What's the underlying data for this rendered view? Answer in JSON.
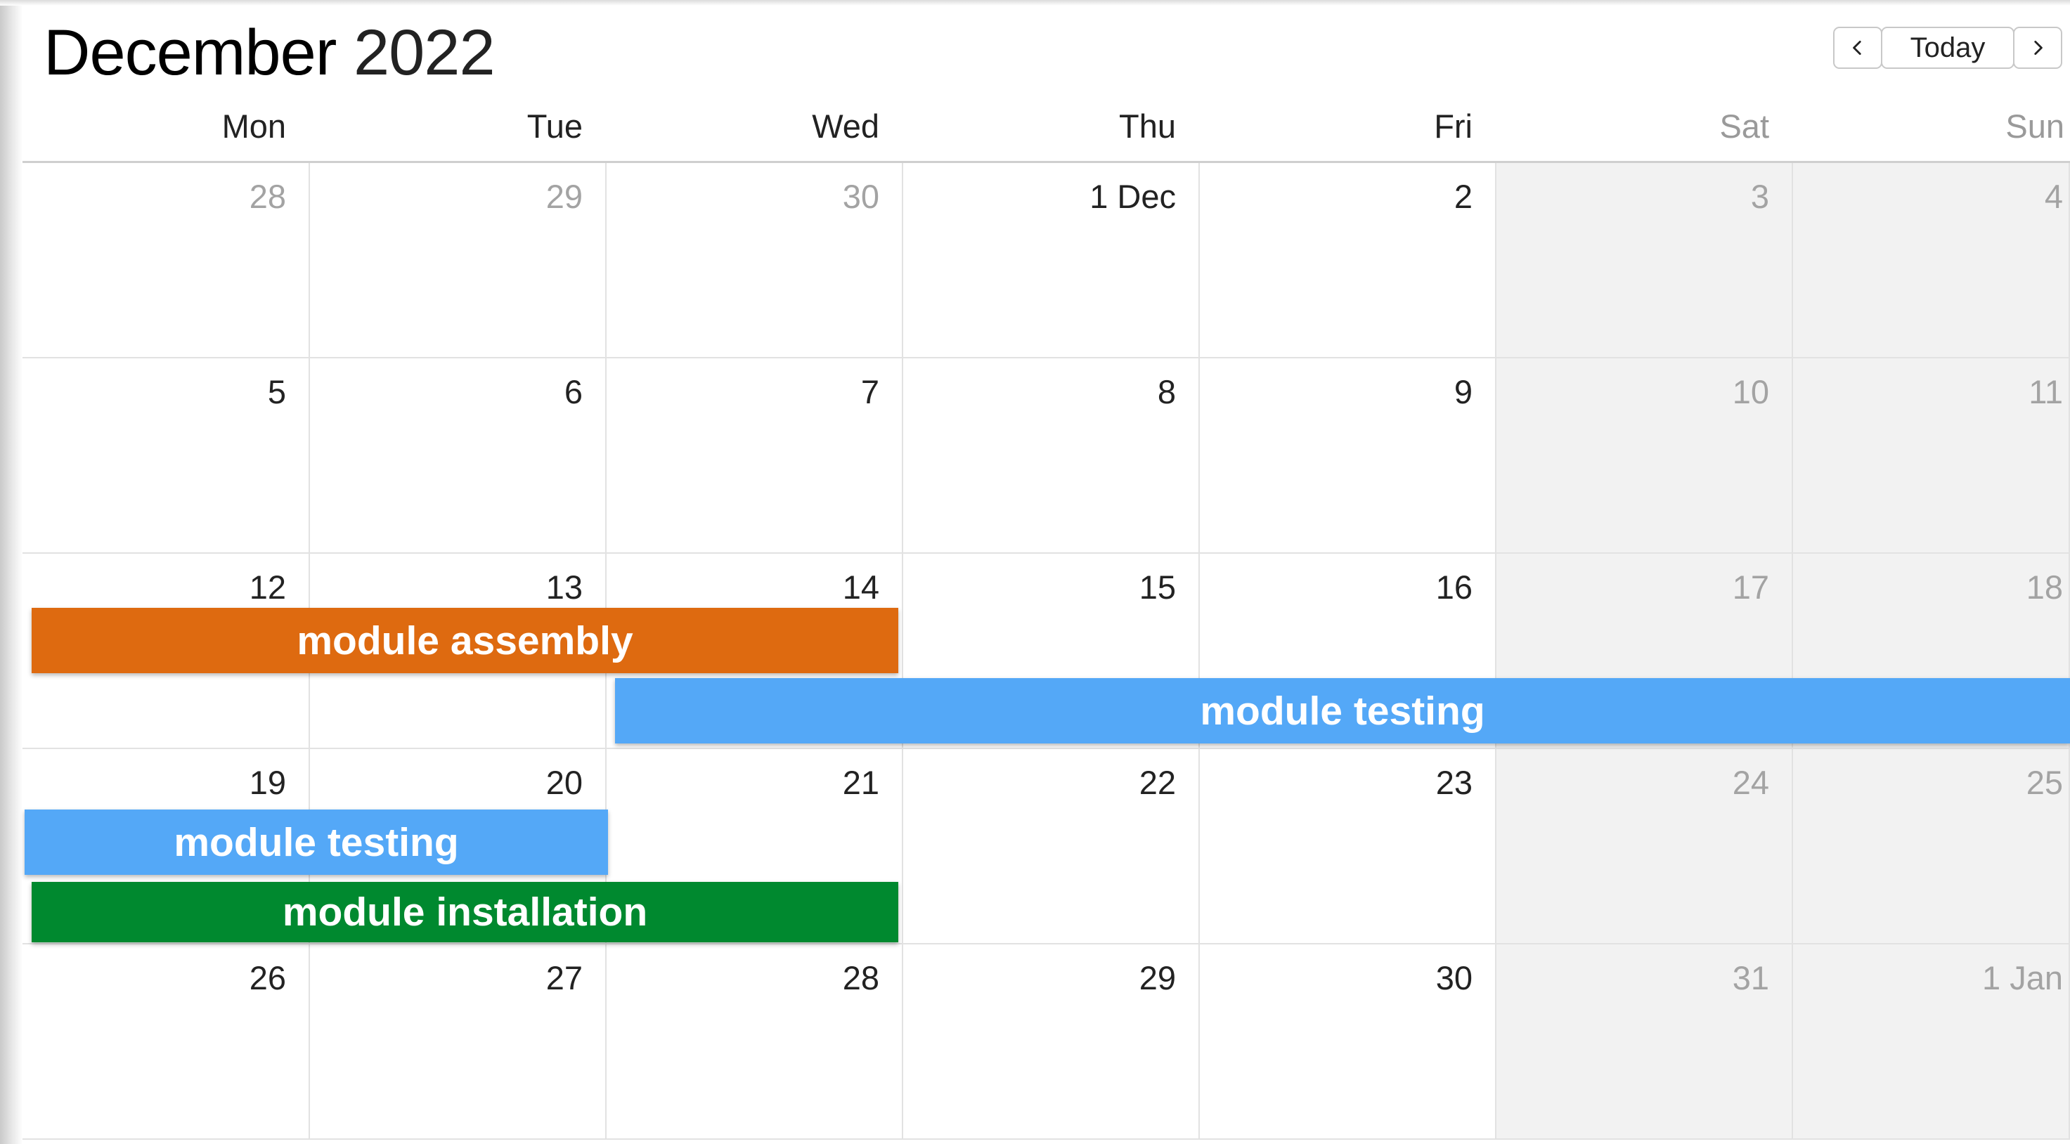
{
  "header": {
    "month": "December",
    "year": "2022",
    "prev_icon": "chevron-left-icon",
    "next_icon": "chevron-right-icon",
    "today_label": "Today"
  },
  "weekdays": [
    "Mon",
    "Tue",
    "Wed",
    "Thu",
    "Fri",
    "Sat",
    "Sun"
  ],
  "weeks": [
    [
      "28",
      "29",
      "30",
      "1 Dec",
      "2",
      "3",
      "4"
    ],
    [
      "5",
      "6",
      "7",
      "8",
      "9",
      "10",
      "11"
    ],
    [
      "12",
      "13",
      "14",
      "15",
      "16",
      "17",
      "18"
    ],
    [
      "19",
      "20",
      "21",
      "22",
      "23",
      "24",
      "25"
    ],
    [
      "26",
      "27",
      "28",
      "29",
      "30",
      "31",
      "1 Jan"
    ]
  ],
  "events": [
    {
      "label": "module assembly",
      "color": "#de6a10"
    },
    {
      "label": "module testing",
      "color": "#54a8f7"
    },
    {
      "label": "module testing",
      "color": "#54a8f7"
    },
    {
      "label": "module installation",
      "color": "#00892f"
    }
  ],
  "colors": {
    "weekend_background": "#f2f2f2",
    "muted_text": "#a3a3a3",
    "grid_line": "#e2e2e2"
  }
}
